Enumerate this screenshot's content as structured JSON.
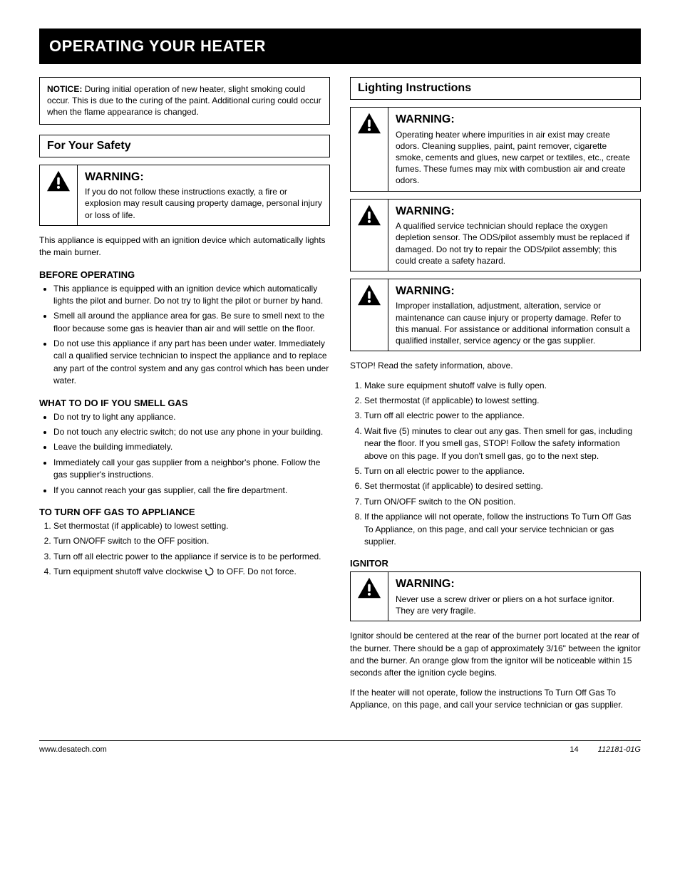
{
  "title_bar": "OPERATING YOUR HEATER",
  "note": {
    "label": "NOTICE:",
    "text": "During initial operation of new heater, slight smoking could occur. This is due to the curing of the paint. Additional curing could occur when the flame appearance is changed."
  },
  "left": {
    "section_header": "For Your Safety",
    "warning": {
      "title": "WARNING:",
      "body": "If you do not follow these instructions exactly, a fire or explosion may result causing property damage, personal injury or loss of life."
    },
    "intro": "This appliance is equipped with an ignition device which automatically lights the main burner.",
    "sub_before": "BEFORE OPERATING",
    "before_list": [
      "This appliance is equipped with an ignition device which automatically lights the pilot and burner. Do not try to light the pilot or burner by hand.",
      "Smell all around the appliance area for gas. Be sure to smell next to the floor because some gas is heavier than air and will settle on the floor.",
      "Do not use this appliance if any part has been under water. Immediately call a qualified service technician to inspect the appliance and to replace any part of the control system and any gas control which has been under water."
    ],
    "sub_smell": "WHAT TO DO IF YOU SMELL GAS",
    "smell_list": [
      "Do not try to light any appliance.",
      "Do not touch any electric switch; do not use any phone in your building.",
      "Leave the building immediately.",
      "Immediately call your gas supplier from a neighbor's phone. Follow the gas supplier's instructions.",
      "If you cannot reach your gas supplier, call the fire department."
    ],
    "sub_off": "TO TURN OFF GAS TO APPLIANCE",
    "off_list": [
      "Set thermostat (if applicable) to lowest setting.",
      "Turn ON/OFF switch to the OFF position.",
      "Turn off all electric power to the appliance if service is to be performed.",
      "Turn equipment shutoff valve clockwise"
    ],
    "off_tail": "<svg style=\"vertical-align:-3px\" width=\"14\" height=\"14\" viewBox=\"0 0 14 14\"><path d=\"M7 2 A5 5 0 1 1 2.5 4.5\" fill=\"none\" stroke=\"#000\" stroke-width=\"1.2\"/><path d=\"M2.5 4.5 l-2 -1 l1.2 2.8 z\" fill=\"#000\"/></svg> to OFF. Do not force."
  },
  "right": {
    "section_header": "Lighting Instructions",
    "callouts": [
      {
        "title": "WARNING:",
        "body": "Operating heater where impurities in air exist may create odors. Cleaning supplies, paint, paint remover, cigarette smoke, cements and glues, new carpet or textiles, etc., create fumes. These fumes may mix with combustion air and create odors."
      },
      {
        "title": "WARNING:",
        "body": "A qualified service technician should replace the oxygen depletion sensor. The ODS/pilot assembly must be replaced if damaged. Do not try to repair the ODS/pilot assembly; this could create a safety hazard."
      },
      {
        "title": "WARNING:",
        "body": "Improper installation, adjustment, alteration, service or maintenance can cause injury or property damage. Refer to this manual. For assistance or additional information consult a qualified installer, service agency or the gas supplier."
      }
    ],
    "steps_intro": "STOP! Read the safety information, above.",
    "steps": [
      "Make sure equipment shutoff valve is fully open.",
      "Set thermostat (if applicable) to lowest setting.",
      "Turn off all electric power to the appliance.",
      "Wait five (5) minutes to clear out any gas. Then smell for gas, including near the floor. If you smell gas, STOP! Follow the safety information above on this page. If you don't smell gas, go to the next step.",
      "Turn on all electric power to the appliance.",
      "Set thermostat (if applicable) to desired setting.",
      "Turn ON/OFF switch to the ON position.",
      "If the appliance will not operate, follow the instructions To Turn Off Gas To Appliance, on this page, and call your service technician or gas supplier."
    ],
    "ignitor_heading": "IGNITOR",
    "ignitor_warning": {
      "title": "WARNING:",
      "body": "Never use a screw driver or pliers on a hot surface ignitor. They are very fragile."
    },
    "ignitor_p1": "Ignitor should be centered at the rear of the burner port located at the rear of the burner. There should be a gap of approximately 3/16\" between the ignitor and the burner. An orange glow from the ignitor will be noticeable within 15 seconds after the ignition cycle begins.",
    "ignitor_p2": "If the heater will not operate, follow the instructions To Turn Off Gas To Appliance, on this page, and call your service technician or gas supplier."
  },
  "footer": {
    "left": "www.desatech.com",
    "page": "14",
    "right": "112181-01G"
  }
}
